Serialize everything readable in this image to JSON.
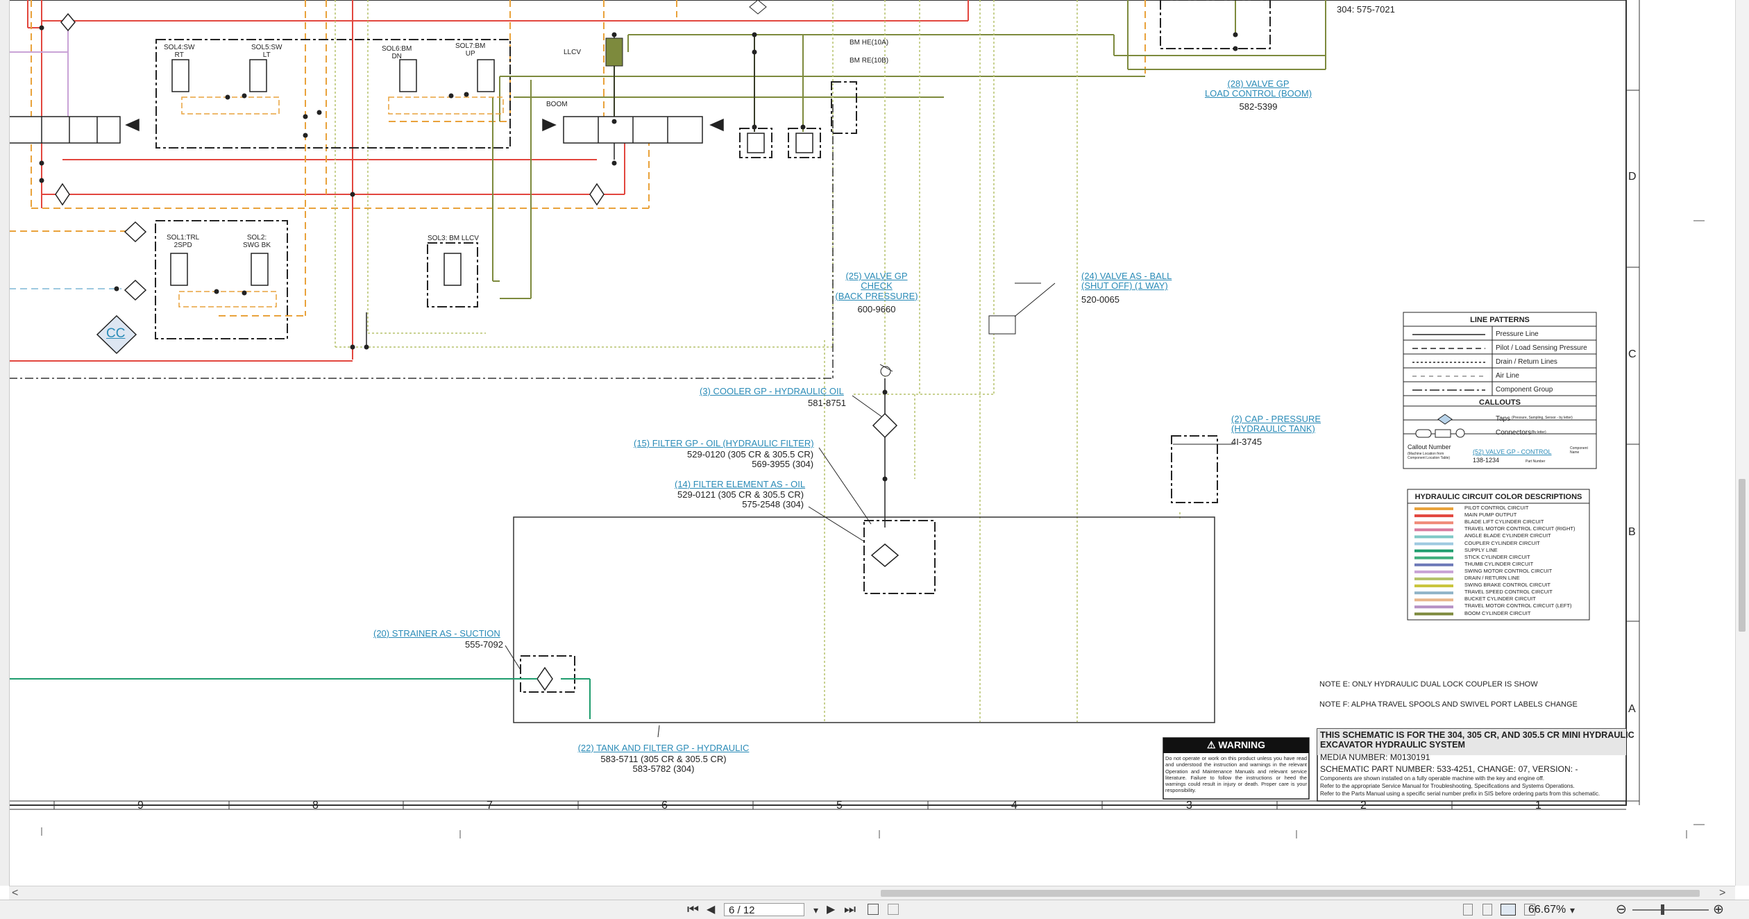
{
  "schematic": {
    "labels": {
      "sol4": "SOL4:SW\nRT",
      "sol5": "SOL5:SW\nLT",
      "sol6": "SOL6:BM\nDN",
      "sol7": "SOL7:BM\nUP",
      "llcv": "LLCV",
      "boom": "BOOM",
      "bm_he": "BM HE(10A)",
      "bm_re": "BM RE(10B)",
      "sol1": "SOL1:TRL\n2SPD",
      "sol2": "SOL2:\nSWG BK",
      "sol3": "SOL3: BM LLCV",
      "cc": "CC",
      "top_right_partno": "304: 575-7021"
    },
    "callouts": {
      "c28_title": "(28) VALVE GP\nLOAD CONTROL (BOOM)",
      "c28_part": "582-5399",
      "c25_title": "(25) VALVE GP\nCHECK\n(BACK PRESSURE)",
      "c25_part": "600-9660",
      "c24_title": "(24) VALVE AS - BALL\n(SHUT OFF) (1 WAY)",
      "c24_part": "520-0065",
      "c3_title": "(3) COOLER GP - HYDRAULIC OIL",
      "c3_part": "581-8751",
      "c2_title": "(2) CAP - PRESSURE\n(HYDRAULIC TANK)",
      "c2_part": "4I-3745",
      "c15_title": "(15) FILTER GP - OIL (HYDRAULIC FILTER)",
      "c15_part": "529-0120 (305 CR & 305.5 CR)\n569-3955 (304)",
      "c14_title": "(14) FILTER ELEMENT AS - OIL",
      "c14_part": "529-0121 (305 CR & 305.5 CR)\n575-2548 (304)",
      "c20_title": "(20) STRAINER AS - SUCTION",
      "c20_part": "555-7092",
      "c22_title": "(22) TANK AND FILTER GP - HYDRAULIC",
      "c22_part": "583-5711 (305 CR & 305.5 CR)\n583-5782 (304)"
    },
    "line_patterns": {
      "title": "LINE PATTERNS",
      "items": [
        "Pressure Line",
        "Pilot / Load Sensing Pressure",
        "Drain / Return Lines",
        "Air Line",
        "Component Group"
      ],
      "callouts_title": "CALLOUTS",
      "taps": "Taps",
      "taps_small": "(Pressure, Sampling, Sensor - by letter)",
      "connectors": "Connectors",
      "connectors_small": "(By letter)",
      "callout_number": "Callout Number",
      "callout_number_small": "(Machine Location from\nComponent Location Table)",
      "sample_link": "(52) VALVE GP - CONTROL",
      "sample_part": "138-1234",
      "component_name": "Component\nName",
      "part_number": "Part Number"
    },
    "color_legend": {
      "title": "HYDRAULIC CIRCUIT COLOR DESCRIPTIONS",
      "items": [
        {
          "label": "PILOT CONTROL CIRCUIT",
          "color": "#e9a23b"
        },
        {
          "label": "MAIN PUMP OUTPUT",
          "color": "#e2463e"
        },
        {
          "label": "BLADE LIFT CYLINDER CIRCUIT",
          "color": "#f08a78"
        },
        {
          "label": "TRAVEL MOTOR CONTROL CIRCUIT (RIGHT)",
          "color": "#d87b9e"
        },
        {
          "label": "ANGLE BLADE CYLINDER CIRCUIT",
          "color": "#7fc8c6"
        },
        {
          "label": "COUPLER CYLINDER CIRCUIT",
          "color": "#9ec9e0"
        },
        {
          "label": "SUPPLY LINE",
          "color": "#1f9d6e"
        },
        {
          "label": "STICK CYLINDER CIRCUIT",
          "color": "#3fae7c"
        },
        {
          "label": "THUMB CYLINDER CIRCUIT",
          "color": "#6d79b8"
        },
        {
          "label": "SWING MOTOR CONTROL CIRCUIT",
          "color": "#c9a3d6"
        },
        {
          "label": "DRAIN / RETURN LINE",
          "color": "#b5c26b"
        },
        {
          "label": "SWING BRAKE CONTROL CIRCUIT",
          "color": "#c9c43a"
        },
        {
          "label": "TRAVEL SPEED CONTROL CIRCUIT",
          "color": "#8fb3c7"
        },
        {
          "label": "BUCKET CYLINDER CIRCUIT",
          "color": "#e8b58a"
        },
        {
          "label": "TRAVEL MOTOR CONTROL CIRCUIT (LEFT)",
          "color": "#b58fc4"
        },
        {
          "label": "BOOM CYLINDER CIRCUIT",
          "color": "#7d8a3d"
        }
      ]
    },
    "notes": {
      "e": "NOTE E: ONLY HYDRAULIC DUAL LOCK COUPLER IS SHOW",
      "f": "NOTE F: ALPHA TRAVEL SPOOLS AND SWIVEL PORT LABELS CHANGE"
    },
    "warning": {
      "title": "WARNING",
      "text": "Do not operate or work on this product unless you have read and understood the instruction and warnings in the relevant Operation and Maintenance Manuals and relevant service literature. Failure to follow the instructions or heed the warnings could result in injury or death. Proper care is your responsibility."
    },
    "title_block": {
      "title": "THIS SCHEMATIC IS FOR THE 304, 305 CR, AND 305.5 CR MINI HYDRAULIC\nEXCAVATOR HYDRAULIC SYSTEM",
      "media": "MEDIA NUMBER: M0130191",
      "part": "SCHEMATIC PART NUMBER: 533-4251, CHANGE: 07, VERSION: -",
      "line1": "Components are shown installed on a fully operable machine with the key and engine off.",
      "line2": "Refer to the appropriate Service Manual for Troubleshooting, Specifications and Systems Operations.",
      "line3": "Refer to the Parts Manual using a specific serial number prefix in SIS before ordering parts from this schematic."
    },
    "grid": {
      "columns": [
        "9",
        "8",
        "7",
        "6",
        "5",
        "4",
        "3",
        "2",
        "1"
      ],
      "rows": [
        "D",
        "C",
        "B",
        "A"
      ]
    }
  },
  "toolbar": {
    "first_page": "⏮",
    "prev_page": "◀",
    "page_value": "6 / 12",
    "page_dropdown": "▾",
    "next_page": "▶",
    "last_page": "⏭",
    "zoom": "66.67%",
    "zoom_dropdown": "▾",
    "zoom_out": "⊖",
    "zoom_in": "⊕"
  },
  "scrollbar": {
    "left_arrow": "<",
    "right_arrow": ">"
  }
}
